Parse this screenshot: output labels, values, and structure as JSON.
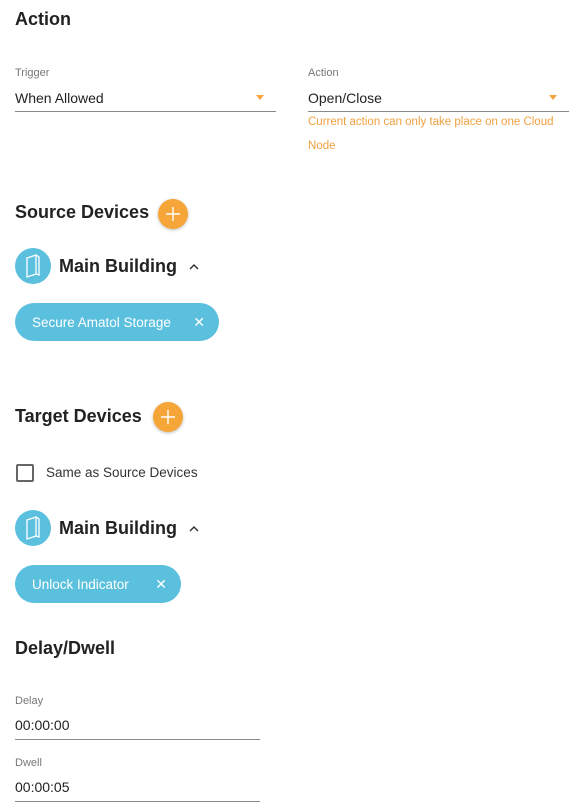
{
  "action_section": {
    "title": "Action",
    "trigger": {
      "label": "Trigger",
      "value": "When Allowed"
    },
    "action": {
      "label": "Action",
      "value": "Open/Close",
      "hint": "Current action can only take place on one Cloud Node"
    }
  },
  "source_section": {
    "title": "Source Devices",
    "building": {
      "name": "Main Building"
    },
    "chips": [
      {
        "label": "Secure Amatol Storage"
      }
    ]
  },
  "target_section": {
    "title": "Target Devices",
    "same_as_source": {
      "label": "Same as Source Devices",
      "checked": false
    },
    "building": {
      "name": "Main Building"
    },
    "chips": [
      {
        "label": "Unlock Indicator"
      }
    ]
  },
  "delay_section": {
    "title": "Delay/Dwell",
    "delay": {
      "label": "Delay",
      "value": "00:00:00"
    },
    "dwell": {
      "label": "Dwell",
      "value": "00:00:05"
    }
  },
  "colors": {
    "accent_orange": "#f6a538",
    "chip_blue": "#5bc0de",
    "hint_orange": "#f0a040"
  }
}
